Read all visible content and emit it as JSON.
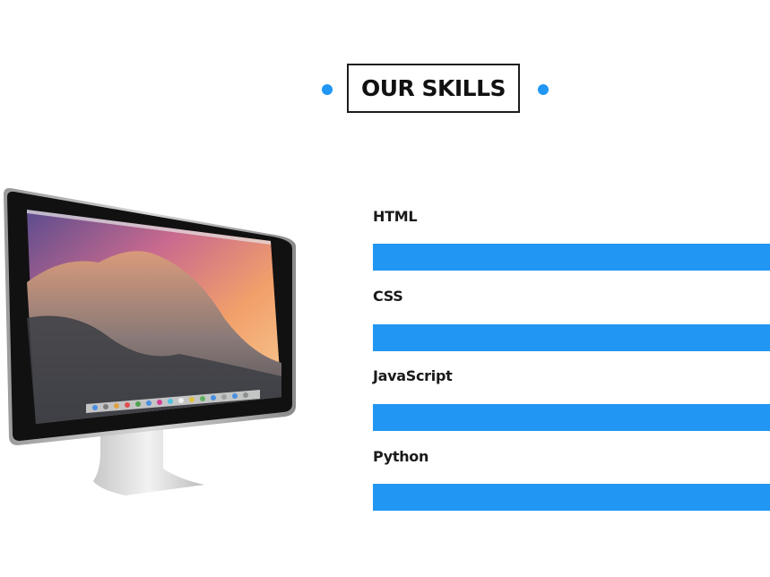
{
  "header": {
    "title": "OUR SKILLS",
    "accent_color": "#2196f3"
  },
  "illustration": {
    "icon": "desktop-monitor-icon"
  },
  "skills": [
    {
      "label": "HTML",
      "level_percent": 100
    },
    {
      "label": "CSS",
      "level_percent": 100
    },
    {
      "label": "JavaScript",
      "level_percent": 100
    },
    {
      "label": "Python",
      "level_percent": 100
    }
  ]
}
